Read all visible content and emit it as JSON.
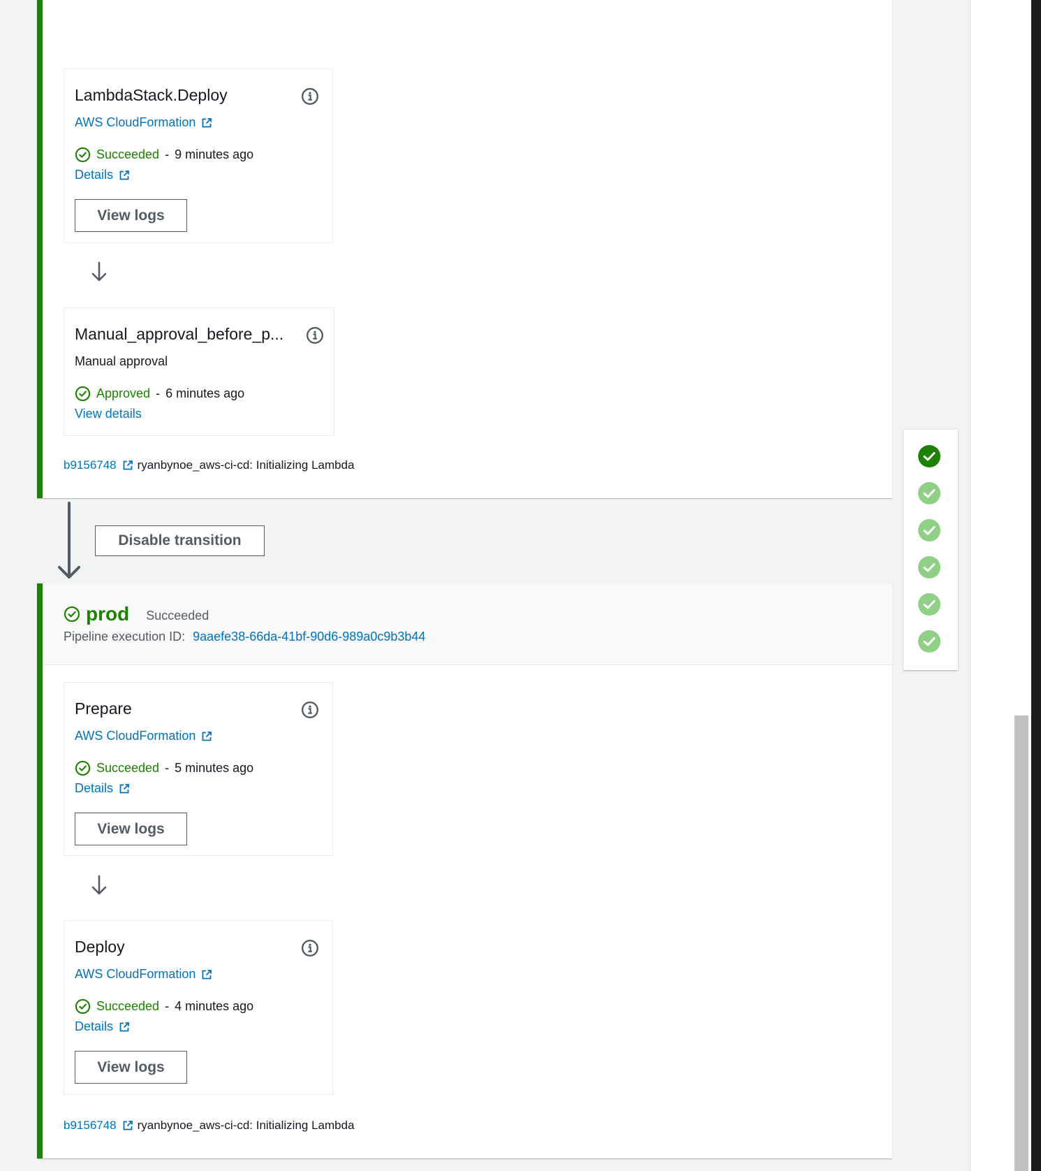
{
  "colors": {
    "success": "#1d8102",
    "link": "#0073bb",
    "stage_border": "#1d8102",
    "done_dot": "#8fcf86"
  },
  "stage1": {
    "actions": [
      {
        "title": "LambdaStack.Deploy",
        "provider": "AWS CloudFormation",
        "status": "Succeeded",
        "time": "9 minutes ago",
        "details": "Details",
        "button": "View logs"
      },
      {
        "title": "Manual_approval_before_p...",
        "provider": "Manual approval",
        "status": "Approved",
        "time": "6 minutes ago",
        "details": "View details"
      }
    ],
    "commit": {
      "sha": "b9156748",
      "message": "ryanbynoe_aws-ci-cd: Initializing Lambda"
    }
  },
  "transition": {
    "button": "Disable transition"
  },
  "stage2": {
    "name": "prod",
    "status": "Succeeded",
    "execution_label": "Pipeline execution ID:",
    "execution_id": "9aaefe38-66da-41bf-90d6-989a0c9b3b44",
    "actions": [
      {
        "title": "Prepare",
        "provider": "AWS CloudFormation",
        "status": "Succeeded",
        "time": "5 minutes ago",
        "details": "Details",
        "button": "View logs"
      },
      {
        "title": "Deploy",
        "provider": "AWS CloudFormation",
        "status": "Succeeded",
        "time": "4 minutes ago",
        "details": "Details",
        "button": "View logs"
      }
    ],
    "commit": {
      "sha": "b9156748",
      "message": "ryanbynoe_aws-ci-cd: Initializing Lambda"
    }
  },
  "mini_nav": {
    "stages": [
      "current",
      "done",
      "done",
      "done",
      "done",
      "done"
    ]
  },
  "separator": "-",
  "icons": {
    "info": "info-icon",
    "external": "external-link-icon",
    "status": "check-circle-icon",
    "arrow": "arrow-down-icon"
  }
}
